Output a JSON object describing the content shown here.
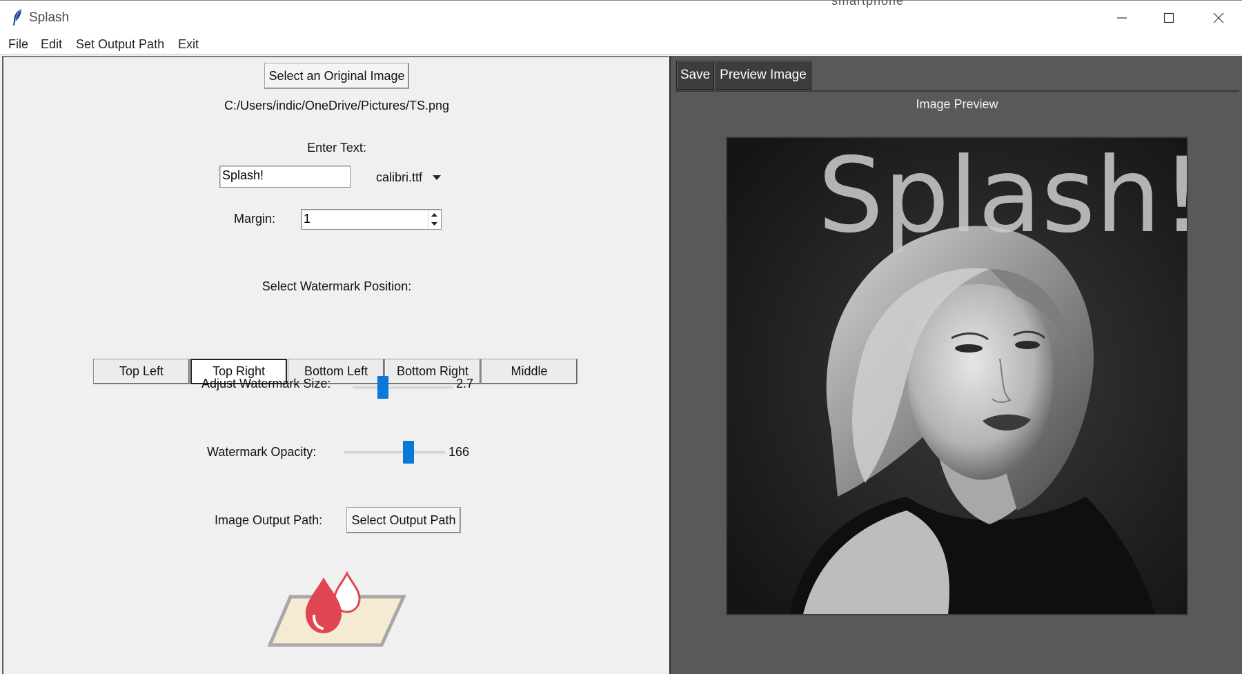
{
  "window": {
    "title": "Splash",
    "overflow_text": "smartphone"
  },
  "menu": {
    "items": [
      "File",
      "Edit",
      "Set Output Path",
      "Exit"
    ]
  },
  "left": {
    "select_image_button": "Select an Original Image",
    "file_path": "C:/Users/indic/OneDrive/Pictures/TS.png",
    "enter_text_label": "Enter Text:",
    "text_value": "Splash!",
    "font_selected": "calibri.ttf",
    "margin_label": "Margin:",
    "margin_value": "1",
    "position_label": "Select Watermark Position:",
    "positions": [
      "Top Left",
      "Top Right",
      "Bottom Left",
      "Bottom Right",
      "Middle"
    ],
    "selected_position": "Top Right",
    "size_label": "Adjust Watermark Size:",
    "size_value": "2.7",
    "size_fraction": 0.28,
    "opacity_label": "Watermark Opacity:",
    "opacity_value": "166",
    "opacity_fraction": 0.65,
    "output_label": "Image Output Path:",
    "output_button": "Select Output Path"
  },
  "right": {
    "save_button": "Save",
    "preview_button": "Preview Image",
    "preview_label": "Image Preview",
    "watermark_text": "Splash!"
  },
  "colors": {
    "accent": "#0a78d7",
    "logo_drop": "#e04552",
    "logo_paper": "#f6ead2",
    "preview_bg": "#5a5957"
  }
}
